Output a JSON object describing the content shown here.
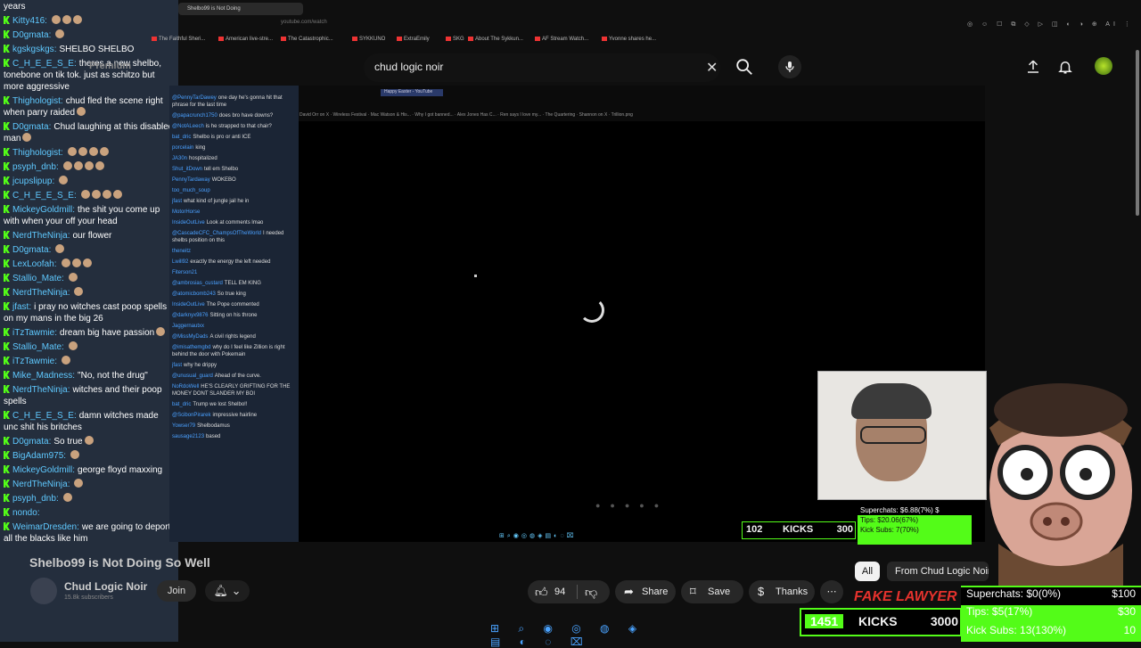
{
  "chat": {
    "messages": [
      {
        "user": "",
        "text": "years"
      },
      {
        "user": "Kitty416",
        "text": ""
      },
      {
        "user": "D0gmata",
        "text": ""
      },
      {
        "user": "kgskgskgs",
        "text": "SHELBO SHELBO"
      },
      {
        "user": "C_H_E_E_S_E",
        "text": "theres a new shelbo, tonebone on tik tok. just as schitzo but more aggressive"
      },
      {
        "user": "Thighologist",
        "text": "chud fled the scene right when parry raided"
      },
      {
        "user": "D0gmata",
        "text": "Chud laughing at this disabled man"
      },
      {
        "user": "Thighologist",
        "text": ""
      },
      {
        "user": "psyph_dnb",
        "text": ""
      },
      {
        "user": "jcupslipup",
        "text": ""
      },
      {
        "user": "C_H_E_E_S_E",
        "text": ""
      },
      {
        "user": "MickeyGoldmill",
        "text": "the shit you come up with when your off your head"
      },
      {
        "user": "NerdTheNinja",
        "text": "our flower"
      },
      {
        "user": "D0gmata",
        "text": ""
      },
      {
        "user": "LexLoofah",
        "text": ""
      },
      {
        "user": "Stallio_Mate",
        "text": ""
      },
      {
        "user": "NerdTheNinja",
        "text": ""
      },
      {
        "user": "jfast",
        "text": "i pray no witches cast poop spells on my mans in the big 26"
      },
      {
        "user": "iTzTawmie",
        "text": "dream big have passion"
      },
      {
        "user": "Stallio_Mate",
        "text": ""
      },
      {
        "user": "iTzTawmie",
        "text": ""
      },
      {
        "user": "Mike_Madness",
        "text": "\"No, not the drug\""
      },
      {
        "user": "NerdTheNinja",
        "text": "witches and their poop spells"
      },
      {
        "user": "C_H_E_E_S_E",
        "text": "damn witches made unc shit his britches"
      },
      {
        "user": "D0gmata",
        "text": "So true"
      },
      {
        "user": "BigAdam975",
        "text": ""
      },
      {
        "user": "MickeyGoldmill",
        "text": "george floyd maxxing"
      },
      {
        "user": "NerdTheNinja",
        "text": ""
      },
      {
        "user": "psyph_dnb",
        "text": ""
      },
      {
        "user": "nondo",
        "text": ""
      },
      {
        "user": "WeimarDresden",
        "text": "we are going to deport all the blacks like him"
      }
    ]
  },
  "browser": {
    "tab_title": "Shelbo99 is Not Doing",
    "url_fragment": "youtube.com/watch",
    "bookmarks": [
      "The Faithful Sheri...",
      "American live-stre...",
      "The Catastrophic...",
      "SYKKUNO",
      "ExtraEmily",
      "SKG",
      "About The Sykkun...",
      "AF Stream Watch...",
      "Yvonne shares he..."
    ],
    "toolbar_icons": "◎ ☺ ☐ ⧉ ◇ ▷ ◫ ◐ ◑ ⊕ AI ⋮"
  },
  "youtube": {
    "premium_label": "Premium",
    "search_query": "chud logic noir",
    "video_title": "Shelbo99 is Not Doing So Well",
    "channel_name": "Chud Logic Noir",
    "subscribers": "15.8k subscribers",
    "join_label": "Join",
    "like_count": "94",
    "share_label": "Share",
    "save_label": "Save",
    "thanks_label": "Thanks",
    "more_label": "⋯",
    "chip_all": "All",
    "chip_from": "From Chud Logic Noir"
  },
  "captured_chat": {
    "messages": [
      {
        "user": "@PennyTarDawey",
        "text": "one day he's gonna hit that phrase for the last time"
      },
      {
        "user": "@papacrunch1750",
        "text": "does bro have downs?"
      },
      {
        "user": "@NotALeech",
        "text": "is he strapped to that chair?"
      },
      {
        "user": "bat_dric",
        "text": "Shelbo is pro or anti ICE"
      },
      {
        "user": "porcelain",
        "text": "king"
      },
      {
        "user": "JA30n",
        "text": "hospitalized"
      },
      {
        "user": "Shut_itDown",
        "text": "tell em Shelbo"
      },
      {
        "user": "PennyTardaway",
        "text": "WOKEBO"
      },
      {
        "user": "too_much_soup",
        "text": ""
      },
      {
        "user": "jfast",
        "text": "what kind of jungle jail he in"
      },
      {
        "user": "MotorHorse",
        "text": ""
      },
      {
        "user": "InsideOutLive",
        "text": "Look at comments lmao"
      },
      {
        "user": "@CascadeCFC_ChampsOfTheWorld",
        "text": "I needed shelbs position on this"
      },
      {
        "user": "theneitz",
        "text": ""
      },
      {
        "user": "Lwill92",
        "text": "exactly the energy the left needed"
      },
      {
        "user": "Fiterson21",
        "text": ""
      },
      {
        "user": "@ambrosias_custard",
        "text": "TELL EM KING"
      },
      {
        "user": "@atomicbomb243",
        "text": "So true king"
      },
      {
        "user": "InsideOutLive",
        "text": "The Pope commented"
      },
      {
        "user": "@darknyx9876",
        "text": "Sitting on his throne"
      },
      {
        "user": "Jaggernautxx",
        "text": ""
      },
      {
        "user": "@MissMyDads",
        "text": "A civil rights legend"
      },
      {
        "user": "@imisathemgbd",
        "text": "why do I feel like Zillion is right behind the door with Pokemain"
      },
      {
        "user": "jfast",
        "text": "why he drippy"
      },
      {
        "user": "@unusual_guard",
        "text": "Ahead of the curve."
      },
      {
        "user": "NoRdoWell",
        "text": "HE'S CLEARLY GRIFTING FOR THE MONEY DONT SLANDER MY BOI"
      },
      {
        "user": "bat_dric",
        "text": "Trump we lost Shelbo!!"
      },
      {
        "user": "@ScibonPirarek",
        "text": "impressive hairline"
      },
      {
        "user": "Yowser79",
        "text": "Shelbodamus"
      },
      {
        "user": "sausage2123",
        "text": "based"
      }
    ]
  },
  "video": {
    "captured_tab": "Happy Easter - YouTube",
    "captured_bookmarks": "David Orr on X  ·  Wireless Festival  ·  Mac Watson & His...  ·  Why I got banned...  ·  Alex Jones Has C...  ·  Ren says I love my...  ·  The Quartering  ·  Shannon on X  ·  Trillion.png"
  },
  "overlay_small": {
    "kicks_count": "102",
    "kicks_label": "KICKS",
    "kicks_goal": "300",
    "superchats": "Superchats: $6.88(7%)",
    "superchats_goal": "$",
    "tips": "Tips: $20.06(67%)",
    "kick_subs": "Kick Subs: 7(70%)"
  },
  "overlay_big": {
    "fake_lawyer": "FAKE LAWYER",
    "kicks_count": "1451",
    "kicks_label": "KICKS",
    "kicks_goal": "3000",
    "superchats": "Superchats: $0(0%)",
    "superchats_goal": "$100",
    "tips": "Tips: $5(17%)",
    "tips_goal": "$30",
    "kick_subs": "Kick Subs: 13(130%)",
    "kick_subs_goal": "10"
  },
  "taskbar": {
    "icons": "⊞ ⌕ ◉ ◎ ◍ ◈ ▤ ◐ ◌ ⌧"
  },
  "colors": {
    "kick_green": "#53fc18",
    "username_blue": "#5fc9ff",
    "chat_bg": "#242e3d"
  }
}
